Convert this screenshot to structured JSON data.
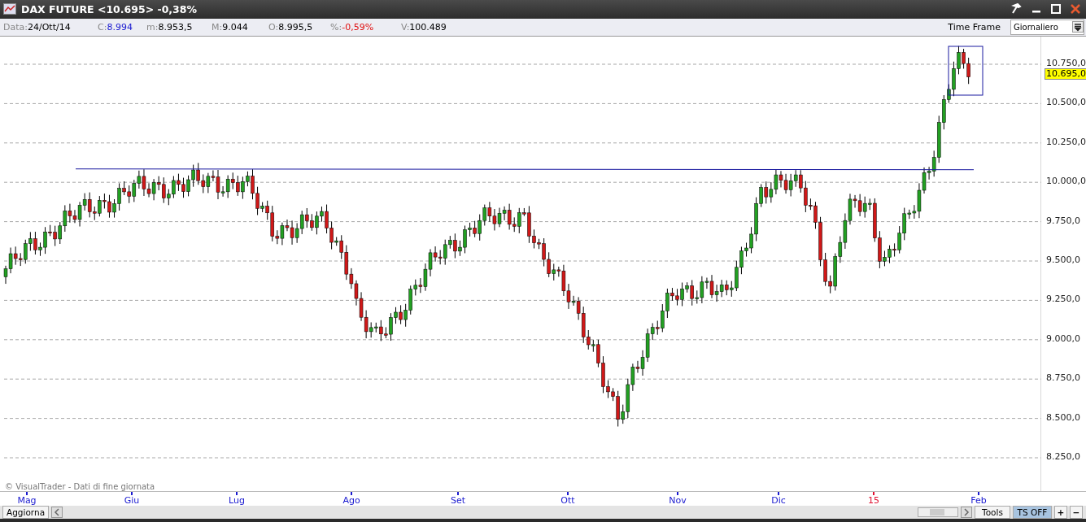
{
  "title_bar": {
    "title": "DAX FUTURE <10.695> -0,38%"
  },
  "info_bar": {
    "fields": [
      {
        "label": "Data:",
        "value": "24/Ott/14",
        "color": "#000000"
      },
      {
        "label": "C:",
        "value": "8.994",
        "color": "#1a1ad0"
      },
      {
        "label": "m:",
        "value": "8.953,5",
        "color": "#000000"
      },
      {
        "label": "M:",
        "value": "9.044",
        "color": "#000000"
      },
      {
        "label": "O:",
        "value": "8.995,5",
        "color": "#000000"
      },
      {
        "label": "%:",
        "value": "-0,59%",
        "color": "#e01010"
      },
      {
        "label": "V:",
        "value": "100.489",
        "color": "#000000"
      }
    ],
    "time_frame_label": "Time Frame",
    "time_frame_value": "Giornaliero"
  },
  "chart": {
    "price_labels": [
      "10.750,0",
      "10.500,0",
      "10.250,0",
      "10.000,0",
      "9.750,0",
      "9.500,0",
      "9.250,0",
      "9.000,0",
      "8.750,0",
      "8.500,0",
      "8.250,0"
    ],
    "current_price": "10.695,0",
    "watermark": "© VisualTrader - Dati di fine giornata",
    "time_labels": [
      {
        "label": "Mag",
        "color": "#1a1ad0"
      },
      {
        "label": "Giu",
        "color": "#1a1ad0"
      },
      {
        "label": "Lug",
        "color": "#1a1ad0"
      },
      {
        "label": "Ago",
        "color": "#1a1ad0"
      },
      {
        "label": "Set",
        "color": "#1a1ad0"
      },
      {
        "label": "Ott",
        "color": "#1a1ad0"
      },
      {
        "label": "Nov",
        "color": "#1a1ad0"
      },
      {
        "label": "Dic",
        "color": "#1a1ad0"
      },
      {
        "label": "15",
        "color": "#e01030"
      },
      {
        "label": "Feb",
        "color": "#1a1ad0"
      }
    ]
  },
  "bottom_bar": {
    "refresh_button": "Aggiorna",
    "tools_button": "Tools",
    "ts_button": "TS OFF",
    "zoom_in": "+",
    "zoom_out": "−"
  }
}
